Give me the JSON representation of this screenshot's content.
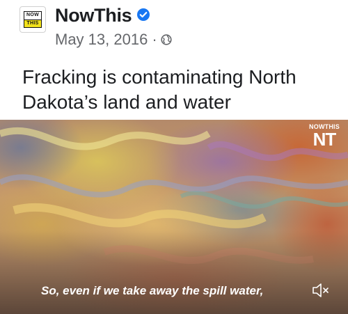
{
  "post": {
    "page_name": "NowThis",
    "avatar_top": "NOW",
    "avatar_bottom": "THIS",
    "date": "May 13, 2016",
    "separator": "·",
    "privacy_icon": "globe-icon",
    "verified_icon": "verified-badge-icon",
    "text": "Fracking is contaminating North Dakota’s land and water"
  },
  "video": {
    "watermark_small": "NOWTHIS",
    "watermark_big": "NT",
    "caption": "So, even if we take away the spill water,",
    "mute_icon": "speaker-muted-icon"
  },
  "colors": {
    "verified": "#1877f2",
    "logo_yellow": "#f2e21c",
    "meta_text": "#65676b"
  }
}
